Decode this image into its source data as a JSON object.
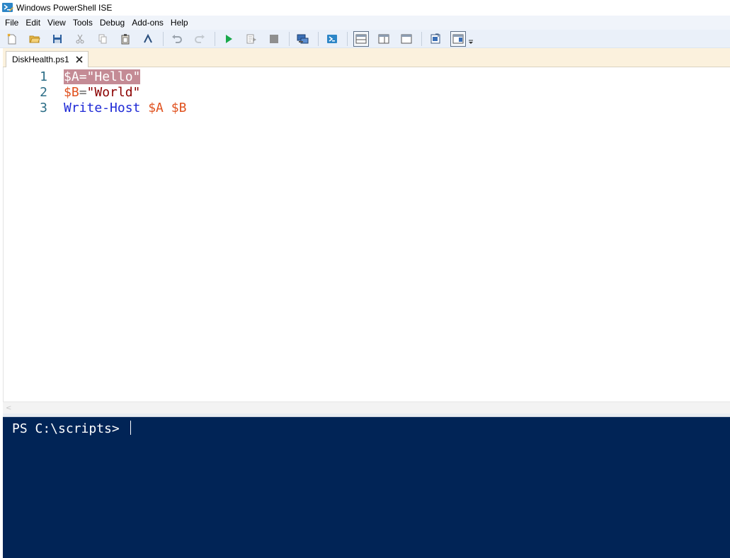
{
  "window": {
    "title": "Windows PowerShell ISE"
  },
  "menu": [
    "File",
    "Edit",
    "View",
    "Tools",
    "Debug",
    "Add-ons",
    "Help"
  ],
  "toolbar": {
    "buttons": [
      "new-icon",
      "open-icon",
      "save-icon",
      "cut-icon",
      "copy-icon",
      "paste-icon",
      "clear-icon",
      "undo-icon",
      "redo-icon",
      "run-icon",
      "run-selection-icon",
      "stop-icon",
      "remote-powershell-icon",
      "powershell-console-icon",
      "layout-script-top-icon",
      "layout-script-right-icon",
      "layout-script-max-icon",
      "show-script-pane-icon",
      "show-command-addon-icon",
      "customize-toolbar-icon"
    ]
  },
  "tab": {
    "label": "DiskHealth.ps1",
    "close_glyph": "✕"
  },
  "editor": {
    "lines": [
      {
        "num": "1",
        "tokens": [
          {
            "t": "$A",
            "k": "var"
          },
          {
            "t": "=",
            "k": "op"
          },
          {
            "t": "\"Hello\"",
            "k": "str"
          }
        ],
        "highlighted": true
      },
      {
        "num": "2",
        "tokens": [
          {
            "t": "$B",
            "k": "var"
          },
          {
            "t": "=",
            "k": "op"
          },
          {
            "t": "\"World\"",
            "k": "str"
          }
        ]
      },
      {
        "num": "3",
        "tokens": [
          {
            "t": "Write-Host",
            "k": "cmd"
          },
          {
            "t": " ",
            "k": "op"
          },
          {
            "t": "$A",
            "k": "var"
          },
          {
            "t": " ",
            "k": "op"
          },
          {
            "t": "$B",
            "k": "var"
          }
        ]
      }
    ]
  },
  "console": {
    "prompt": "PS C:\\scripts> "
  },
  "colors": {
    "console_bg": "#012456",
    "tab_strip_bg": "#fbf1dd",
    "variable": "#e0521f",
    "string": "#8b0000",
    "command": "#1f2ad6",
    "line_number": "#2b6d86"
  }
}
